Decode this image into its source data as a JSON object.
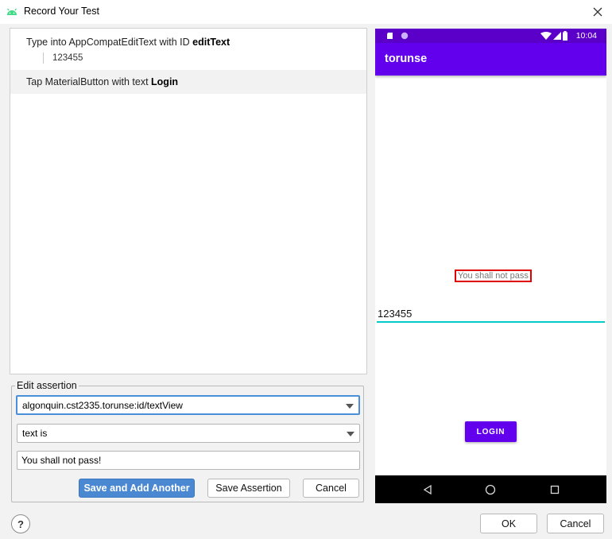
{
  "window": {
    "title": "Record Your Test"
  },
  "steps": [
    {
      "prefix": "Type into AppCompatEditText with ID ",
      "target": "editText",
      "value": "123455"
    },
    {
      "prefix": "Tap MaterialButton with text ",
      "target": "Login"
    }
  ],
  "assertion": {
    "legend": "Edit assertion",
    "element_selected": "algonquin.cst2335.torunse:id/textView",
    "condition_selected": "text is",
    "expected_value": "You shall not pass!",
    "buttons": {
      "save_add": "Save and Add Another",
      "save": "Save Assertion",
      "cancel": "Cancel"
    }
  },
  "footer": {
    "help": "?",
    "ok": "OK",
    "cancel": "Cancel"
  },
  "device": {
    "status_time": "10:04",
    "app_title": "torunse",
    "message_text": "You shall not pass",
    "edit_text": "123455",
    "login_label": "LOGIN",
    "colors": {
      "status_bar": "#5a00c8",
      "app_bar": "#6200ee",
      "accent": "#03c9c9",
      "highlight": "#e00000"
    }
  },
  "icons": [
    "android-icon",
    "close-icon",
    "sd-card-icon",
    "circle-icon",
    "wifi-icon",
    "signal-icon",
    "battery-icon",
    "nav-back-icon",
    "nav-home-icon",
    "nav-recents-icon",
    "help-icon"
  ]
}
